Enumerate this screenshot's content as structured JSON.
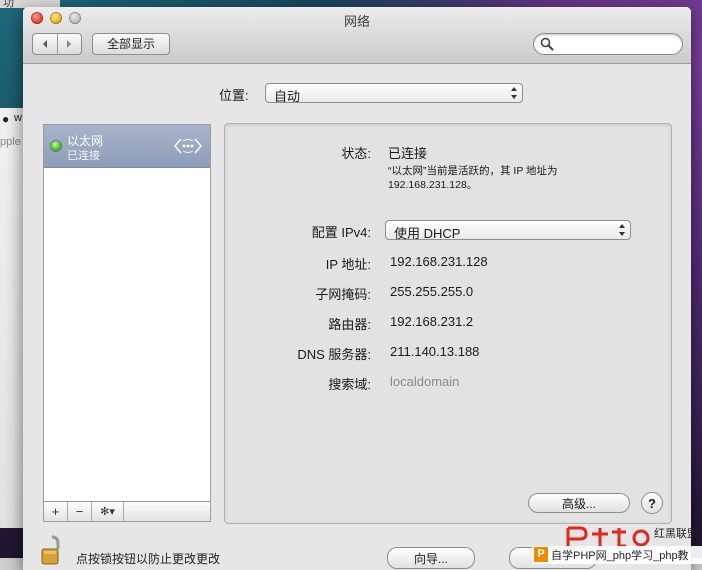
{
  "desktop": {
    "menu_fragment": "功",
    "bg_app_char": "w",
    "bg_app_text": "pple"
  },
  "window": {
    "title": "网络",
    "show_all_label": "全部显示",
    "search_placeholder": ""
  },
  "location": {
    "label": "位置:",
    "value": "自动"
  },
  "services": [
    {
      "name": "以太网",
      "status": "已连接",
      "status_color": "#3fbf1a",
      "icon": "ethernet-icon",
      "selected": true
    }
  ],
  "list_toolbar": {
    "add": "+",
    "remove": "−",
    "gear": "✻▾"
  },
  "detail": {
    "status_label": "状态:",
    "status_value": "已连接",
    "status_desc_line1": "“以太网”当前是活跃的，其 IP 地址为",
    "status_desc_line2": "192.168.231.128。",
    "ipv4_label": "配置 IPv4:",
    "ipv4_value": "使用 DHCP",
    "ip_label": "IP 地址:",
    "ip_value": "192.168.231.128",
    "subnet_label": "子网掩码:",
    "subnet_value": "255.255.255.0",
    "router_label": "路由器:",
    "router_value": "192.168.231.2",
    "dns_label": "DNS 服务器:",
    "dns_value": "211.140.13.188",
    "search_domain_label": "搜索域:",
    "search_domain_value": "localdomain",
    "advanced_label": "高级...",
    "help_label": "?"
  },
  "footer": {
    "lock_text": "点按锁按钮以防止更改更改",
    "assist_label": "向导..."
  },
  "watermark": {
    "side_text": "红黑联盟",
    "p_badge": "P",
    "bar_text": "自学PHP网_php学习_php教"
  }
}
